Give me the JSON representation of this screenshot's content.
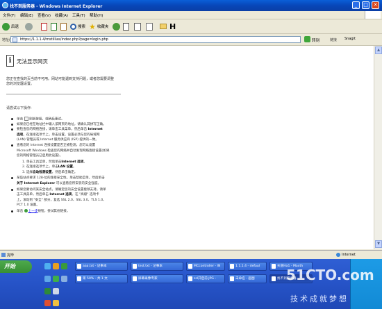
{
  "window": {
    "title": "找不到服务器 - Windows Internet Explorer",
    "controls": [
      "_",
      "□",
      "✕"
    ]
  },
  "menu": [
    "文件(F)",
    "编辑(E)",
    "查看(V)",
    "收藏(A)",
    "工具(T)",
    "帮助(H)"
  ],
  "toolbar": {
    "back_label": "后退",
    "search_label": "搜索",
    "favorites_label": "收藏夹",
    "logo_letter": "H"
  },
  "address": {
    "label": "地址(D)",
    "url": "https://1.1.1.4/mstillias/index.php?page=login.php",
    "go_label": "转到",
    "links_label": "链接",
    "snagit_label": "Snagit"
  },
  "page": {
    "heading": "无法显示网页",
    "intro": [
      "您正在查找的页当前不可用。网站可能遇到支持问题，或者您需要调整",
      "您的浏览器设置。"
    ],
    "try_label": "请尝试以下操作:",
    "lines": [
      {
        "text": "单击 ",
        "bold": "",
        "rest": " 刷新按钮，或稍后重试。",
        "bullet": true,
        "refresh": true
      },
      {
        "text": "如果您已经在地址栏中输入该网页的地址，请确认其拼写正确。",
        "bullet": true
      },
      {
        "text": "要检查您的网络连接，请单击工具菜单，然后单击 ",
        "bold": "Internet",
        "bullet": true
      },
      {
        "text": "",
        "bold": "选项",
        "rest": "。在连接选项卡上，单击设置。设置必须与您的局域网",
        "bullet": false
      },
      {
        "text": "(LAN) 管理员或 Internet 服务供应商 (ISP) 提供的一致。",
        "bullet": false
      },
      {
        "text": "查看您的 Internet 连接设置是否正被检测。您可以设置",
        "bullet": true
      },
      {
        "text": "Microsoft Windows 检查您的网络并自动发现网络连接设置(如果",
        "bullet": false
      },
      {
        "text": "您的网络管理员已启用此设置)。",
        "bullet": false
      },
      {
        "text": "1.   单击工具菜单，然后单击",
        "bold": "Internet 选项",
        "rest": "。",
        "indent": 2
      },
      {
        "text": "2.   在连接选项卡上，单击",
        "bold": "LAN 设置",
        "rest": "。",
        "indent": 2
      },
      {
        "text": "3.   选择",
        "bold": "自动检测设置",
        "rest": "，然后单击确定。",
        "indent": 2
      },
      {
        "text": "某些站点要求 128-位的连接安全性。单击帮助菜单，然后单击",
        "bullet": true
      },
      {
        "text": "",
        "bold": "关于 Internet Explorer",
        "rest": " 可以查看您所安装的安全强度。",
        "bullet": false
      },
      {
        "text": "如果您要访问某安全站点，请确定您的安全设置能够支持。请单",
        "bullet": true
      },
      {
        "text": "击工具菜单，然后单击 ",
        "bold": "Internet 选项",
        "rest": "。在 \"高级\" 选项卡",
        "bullet": false
      },
      {
        "text": "上，滚动到 \"安全\" 部分，复选 SSL 2.0、SSL 3.0、TLS 1.0、",
        "bullet": false
      },
      {
        "text": "PCT 1.0 设置。",
        "bullet": false
      },
      {
        "text": "单击 ",
        "link": "上一步",
        "rest": "按钮，尝试其他链接。",
        "bullet": true,
        "back": true
      }
    ]
  },
  "status": {
    "text": "完毕",
    "zone": "Internet"
  },
  "taskbar": {
    "start_label": "开始",
    "row1": [
      "aaa.txt - 记事本",
      "test.txt - 记事本",
      "MCcontroller - IN",
      "1.1.1.4 - defaul",
      "天道Ha1 - Maxth"
    ],
    "row2": [
      "第 50% - 共 1 文",
      "屏幕录像专家",
      "ssl开启前.JPG -",
      "未命名 - 画图",
      "找不到服务器 -"
    ]
  },
  "watermark": {
    "site": "51CTO.com",
    "slogan": "技术成就梦想"
  }
}
